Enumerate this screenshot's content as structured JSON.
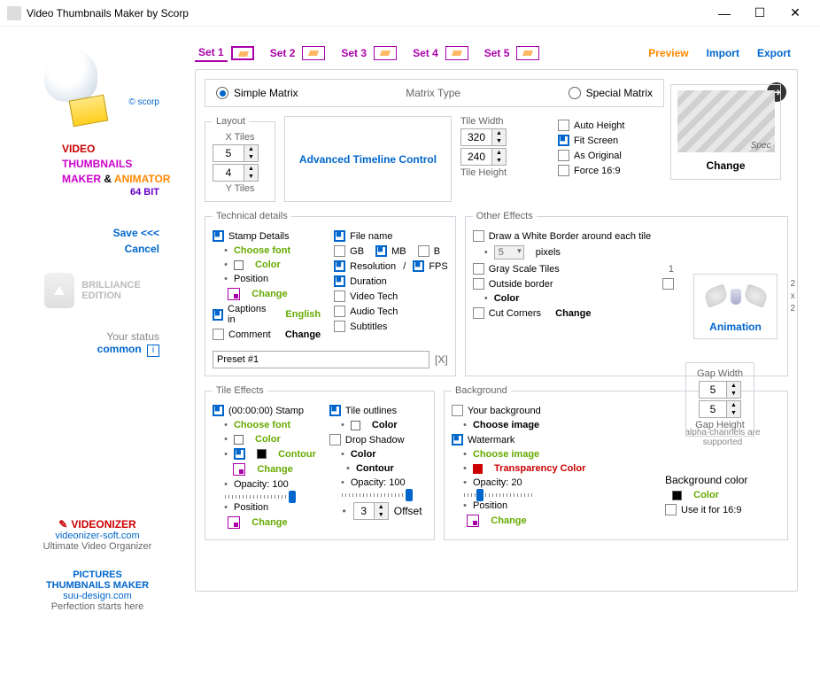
{
  "window": {
    "title": "Video Thumbnails Maker by Scorp"
  },
  "sidebar": {
    "scorp": "© scorp",
    "appname": {
      "video": "VIDEO",
      "thumb": "THUMBNAILS",
      "maker": "MAKER",
      "amp": "&",
      "anim": "ANIMATOR",
      "bit": "64 BIT"
    },
    "save": "Save <<<",
    "cancel": "Cancel",
    "brilliance": "BRILLIANCE EDITION",
    "status_label": "Your status",
    "status_value": "common",
    "videonizer": "VIDEONIZER",
    "videonizer_link": "videonizer-soft.com",
    "videonizer_tag": "Ultimate Video Organizer",
    "ptm1": "PICTURES",
    "ptm2": "THUMBNAILS MAKER",
    "ptm_link": "suu-design.com",
    "ptm_tag": "Perfection starts here"
  },
  "nav": {
    "sets": [
      "Set 1",
      "Set 2",
      "Set 3",
      "Set 4",
      "Set 5"
    ],
    "preview": "Preview",
    "import": "Import",
    "export": "Export"
  },
  "matrix": {
    "simple": "Simple Matrix",
    "type": "Matrix Type",
    "special": "Special Matrix"
  },
  "preview_box": {
    "change": "Change"
  },
  "layout": {
    "legend": "Layout",
    "xtiles": "X Tiles",
    "ytiles": "Y Tiles",
    "xval": "5",
    "yval": "4"
  },
  "adv": "Advanced Timeline Control",
  "tile": {
    "width": "Tile Width",
    "height": "Tile Height",
    "wval": "320",
    "hval": "240"
  },
  "auto": {
    "height": "Auto Height",
    "fit": "Fit Screen",
    "orig": "As Original",
    "force": "Force 16:9"
  },
  "tech": {
    "legend": "Technical  details",
    "stamp": "Stamp Details",
    "choose_font": "Choose font",
    "color": "Color",
    "position": "Position",
    "change": "Change",
    "captions": "Captions in",
    "english": "English",
    "comment": "Comment",
    "filename": "File name",
    "gb": "GB",
    "mb": "MB",
    "b": "B",
    "resolution": "Resolution",
    "fps": "FPS",
    "duration": "Duration",
    "videotech": "Video Tech",
    "audiotech": "Audio Tech",
    "subtitles": "Subtitles",
    "preset": "Preset #1"
  },
  "other": {
    "legend": "Other Effects",
    "whiteborder": "Draw a White Border around each tile",
    "pixels": "pixels",
    "px": "5",
    "gray": "Gray Scale Tiles",
    "outside": "Outside border",
    "color": "Color",
    "cut": "Cut Corners",
    "change": "Change",
    "one": "1"
  },
  "anim": {
    "label": "Animation",
    "n2a": "2",
    "x": "x",
    "n2b": "2"
  },
  "gap": {
    "width": "Gap Width",
    "height": "Gap Height",
    "v1": "5",
    "v2": "5"
  },
  "tileeff": {
    "legend": "Tile Effects",
    "stamp": "(00:00:00) Stamp",
    "choose_font": "Choose font",
    "color": "Color",
    "contour": "Contour",
    "change": "Change",
    "opacity": "Opacity: 100",
    "position": "Position",
    "outlines": "Tile outlines",
    "drop": "Drop Shadow",
    "opacity2": "Opacity: 100",
    "offset": "Offset",
    "offval": "3"
  },
  "bg": {
    "legend": "Background",
    "yourbg": "Your background",
    "choose": "Choose image",
    "watermark": "Watermark",
    "transp": "Transparency Color",
    "opacity": "Opacity: 20",
    "position": "Position",
    "change": "Change",
    "alpha": "alpha-channels are supported",
    "bgcolor": "Background color",
    "color": "Color",
    "use169": "Use it for 16:9"
  }
}
